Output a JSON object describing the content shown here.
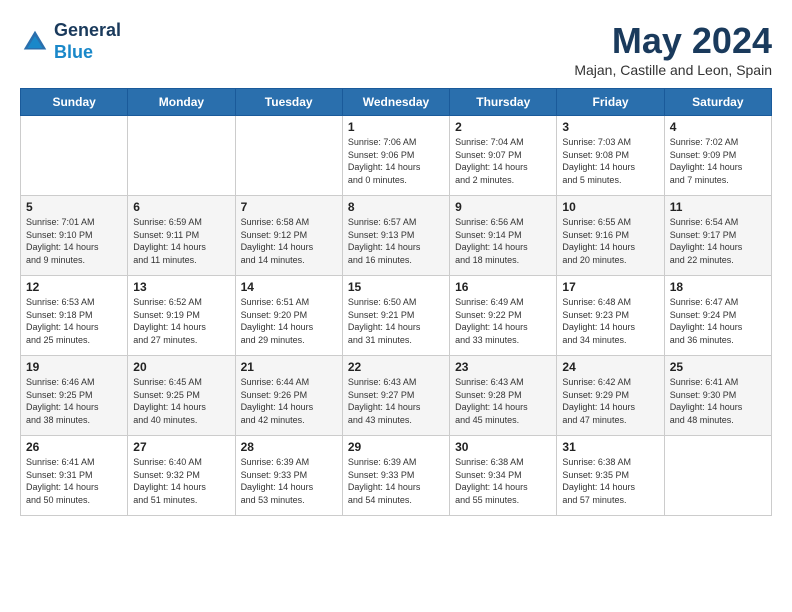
{
  "header": {
    "logo_line1": "General",
    "logo_line2": "Blue",
    "month_title": "May 2024",
    "subtitle": "Majan, Castille and Leon, Spain"
  },
  "days_of_week": [
    "Sunday",
    "Monday",
    "Tuesday",
    "Wednesday",
    "Thursday",
    "Friday",
    "Saturday"
  ],
  "weeks": [
    [
      {
        "day": "",
        "info": ""
      },
      {
        "day": "",
        "info": ""
      },
      {
        "day": "",
        "info": ""
      },
      {
        "day": "1",
        "info": "Sunrise: 7:06 AM\nSunset: 9:06 PM\nDaylight: 14 hours\nand 0 minutes."
      },
      {
        "day": "2",
        "info": "Sunrise: 7:04 AM\nSunset: 9:07 PM\nDaylight: 14 hours\nand 2 minutes."
      },
      {
        "day": "3",
        "info": "Sunrise: 7:03 AM\nSunset: 9:08 PM\nDaylight: 14 hours\nand 5 minutes."
      },
      {
        "day": "4",
        "info": "Sunrise: 7:02 AM\nSunset: 9:09 PM\nDaylight: 14 hours\nand 7 minutes."
      }
    ],
    [
      {
        "day": "5",
        "info": "Sunrise: 7:01 AM\nSunset: 9:10 PM\nDaylight: 14 hours\nand 9 minutes."
      },
      {
        "day": "6",
        "info": "Sunrise: 6:59 AM\nSunset: 9:11 PM\nDaylight: 14 hours\nand 11 minutes."
      },
      {
        "day": "7",
        "info": "Sunrise: 6:58 AM\nSunset: 9:12 PM\nDaylight: 14 hours\nand 14 minutes."
      },
      {
        "day": "8",
        "info": "Sunrise: 6:57 AM\nSunset: 9:13 PM\nDaylight: 14 hours\nand 16 minutes."
      },
      {
        "day": "9",
        "info": "Sunrise: 6:56 AM\nSunset: 9:14 PM\nDaylight: 14 hours\nand 18 minutes."
      },
      {
        "day": "10",
        "info": "Sunrise: 6:55 AM\nSunset: 9:16 PM\nDaylight: 14 hours\nand 20 minutes."
      },
      {
        "day": "11",
        "info": "Sunrise: 6:54 AM\nSunset: 9:17 PM\nDaylight: 14 hours\nand 22 minutes."
      }
    ],
    [
      {
        "day": "12",
        "info": "Sunrise: 6:53 AM\nSunset: 9:18 PM\nDaylight: 14 hours\nand 25 minutes."
      },
      {
        "day": "13",
        "info": "Sunrise: 6:52 AM\nSunset: 9:19 PM\nDaylight: 14 hours\nand 27 minutes."
      },
      {
        "day": "14",
        "info": "Sunrise: 6:51 AM\nSunset: 9:20 PM\nDaylight: 14 hours\nand 29 minutes."
      },
      {
        "day": "15",
        "info": "Sunrise: 6:50 AM\nSunset: 9:21 PM\nDaylight: 14 hours\nand 31 minutes."
      },
      {
        "day": "16",
        "info": "Sunrise: 6:49 AM\nSunset: 9:22 PM\nDaylight: 14 hours\nand 33 minutes."
      },
      {
        "day": "17",
        "info": "Sunrise: 6:48 AM\nSunset: 9:23 PM\nDaylight: 14 hours\nand 34 minutes."
      },
      {
        "day": "18",
        "info": "Sunrise: 6:47 AM\nSunset: 9:24 PM\nDaylight: 14 hours\nand 36 minutes."
      }
    ],
    [
      {
        "day": "19",
        "info": "Sunrise: 6:46 AM\nSunset: 9:25 PM\nDaylight: 14 hours\nand 38 minutes."
      },
      {
        "day": "20",
        "info": "Sunrise: 6:45 AM\nSunset: 9:25 PM\nDaylight: 14 hours\nand 40 minutes."
      },
      {
        "day": "21",
        "info": "Sunrise: 6:44 AM\nSunset: 9:26 PM\nDaylight: 14 hours\nand 42 minutes."
      },
      {
        "day": "22",
        "info": "Sunrise: 6:43 AM\nSunset: 9:27 PM\nDaylight: 14 hours\nand 43 minutes."
      },
      {
        "day": "23",
        "info": "Sunrise: 6:43 AM\nSunset: 9:28 PM\nDaylight: 14 hours\nand 45 minutes."
      },
      {
        "day": "24",
        "info": "Sunrise: 6:42 AM\nSunset: 9:29 PM\nDaylight: 14 hours\nand 47 minutes."
      },
      {
        "day": "25",
        "info": "Sunrise: 6:41 AM\nSunset: 9:30 PM\nDaylight: 14 hours\nand 48 minutes."
      }
    ],
    [
      {
        "day": "26",
        "info": "Sunrise: 6:41 AM\nSunset: 9:31 PM\nDaylight: 14 hours\nand 50 minutes."
      },
      {
        "day": "27",
        "info": "Sunrise: 6:40 AM\nSunset: 9:32 PM\nDaylight: 14 hours\nand 51 minutes."
      },
      {
        "day": "28",
        "info": "Sunrise: 6:39 AM\nSunset: 9:33 PM\nDaylight: 14 hours\nand 53 minutes."
      },
      {
        "day": "29",
        "info": "Sunrise: 6:39 AM\nSunset: 9:33 PM\nDaylight: 14 hours\nand 54 minutes."
      },
      {
        "day": "30",
        "info": "Sunrise: 6:38 AM\nSunset: 9:34 PM\nDaylight: 14 hours\nand 55 minutes."
      },
      {
        "day": "31",
        "info": "Sunrise: 6:38 AM\nSunset: 9:35 PM\nDaylight: 14 hours\nand 57 minutes."
      },
      {
        "day": "",
        "info": ""
      }
    ]
  ]
}
